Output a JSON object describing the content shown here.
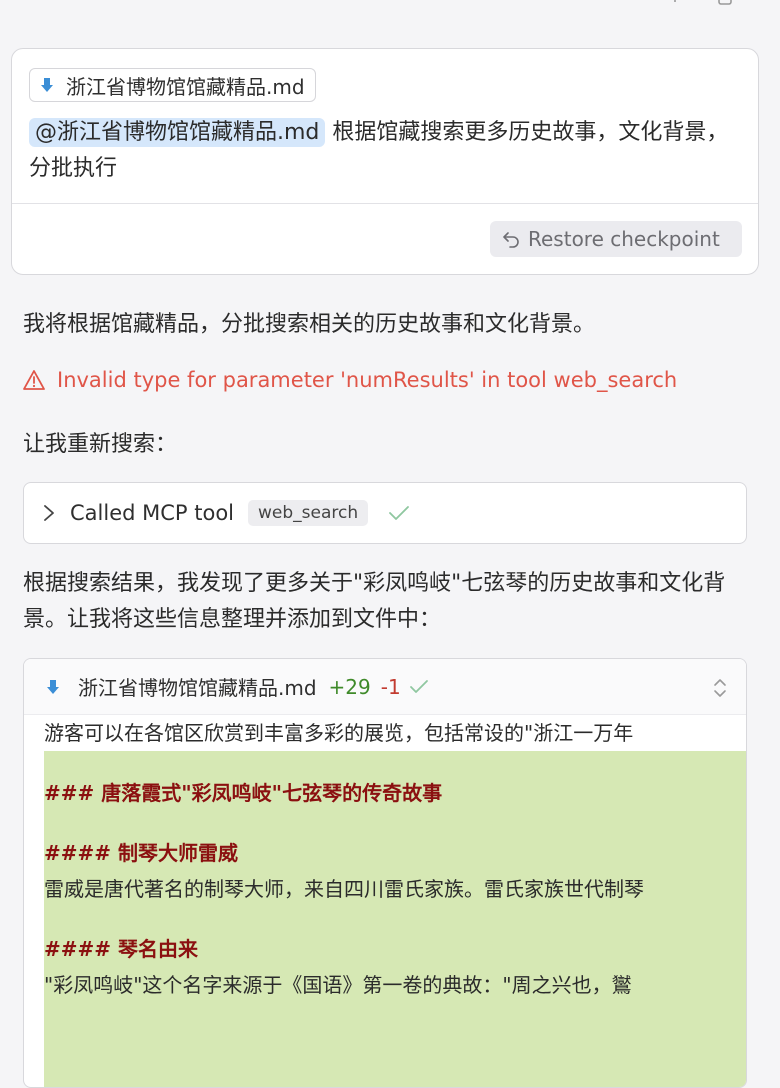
{
  "user_message": {
    "attachment": "浙江省博物馆馆藏精品.md",
    "mention": "@浙江省博物馆馆藏精品.md",
    "text": " 根据馆藏搜索更多历史故事，文化背景，分批执行",
    "restore_label": "Restore checkpoint"
  },
  "assistant": {
    "intro": "我将根据馆藏精品，分批搜索相关的历史故事和文化背景。",
    "error": "Invalid type for parameter 'numResults' in tool web_search",
    "retry": "让我重新搜索：",
    "tool": {
      "label": "Called MCP tool",
      "name": "web_search"
    },
    "summary": "根据搜索结果，我发现了更多关于\"彩凤鸣岐\"七弦琴的历史故事和文化背景。让我将这些信息整理并添加到文件中："
  },
  "diff": {
    "filename": "浙江省博物馆馆藏精品.md",
    "additions": "+29",
    "deletions": "-1",
    "lines": {
      "context": "游客可以在各馆区欣赏到丰富多彩的展览，包括常设的\"浙江一万年",
      "h3": "### 唐落霞式\"彩凤鸣岐\"七弦琴的传奇故事",
      "h4_master": "#### 制琴大师雷威",
      "p_master": "雷威是唐代著名的制琴大师，来自四川雷氏家族。雷氏家族世代制琴",
      "h4_name": "#### 琴名由来",
      "p_name": "\"彩凤鸣岐\"这个名字来源于《国语》第一卷的典故：\"周之兴也，鸑"
    }
  },
  "colors": {
    "error": "#e05548",
    "added_bg": "#d6e8b4",
    "heading": "#8b1010",
    "mention_bg": "#d5e7fb"
  }
}
